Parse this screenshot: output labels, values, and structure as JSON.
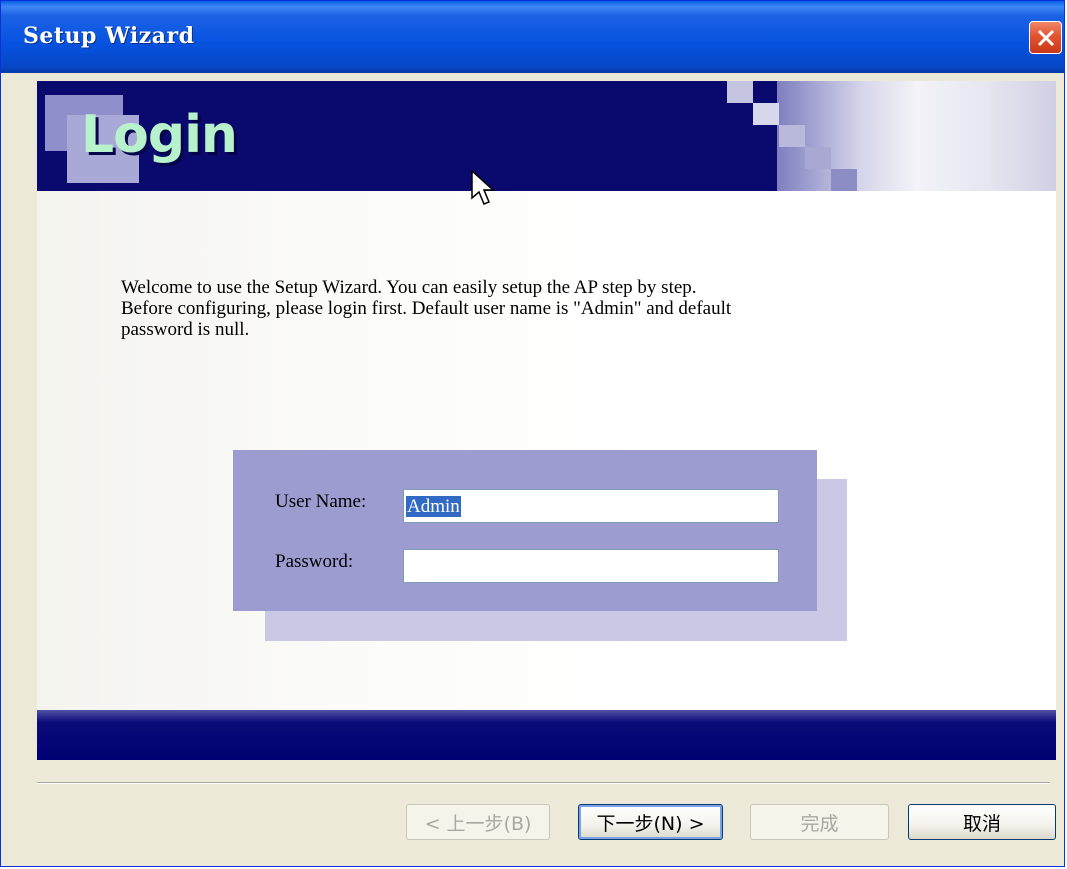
{
  "window": {
    "title": "Setup Wizard"
  },
  "banner": {
    "heading": "Login"
  },
  "welcome": {
    "line1": "Welcome to use the Setup Wizard. You can easily setup the AP step by step.",
    "line2": "Before configuring, please login first. Default user name is \"Admin\" and default",
    "line3": "password is null."
  },
  "form": {
    "username_label": "User Name:",
    "username_value": "Admin",
    "password_label": "Password:",
    "password_value": ""
  },
  "buttons": {
    "back": "< 上一步(B)",
    "next": "下一步(N) >",
    "finish": "完成",
    "cancel": "取消"
  },
  "colors": {
    "titlebar": "#0652df",
    "banner": "#0a0a6e",
    "panel": "#9c9cd0",
    "selection": "#316ac5"
  }
}
